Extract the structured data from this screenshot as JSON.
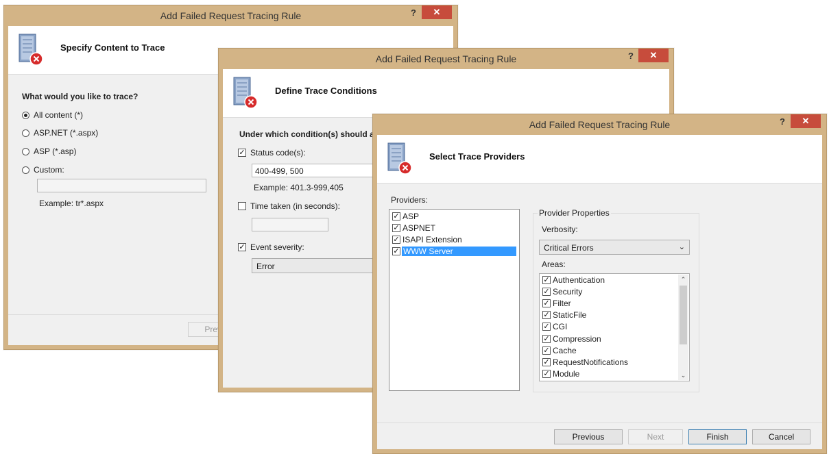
{
  "window_title": "Add Failed Request Tracing Rule",
  "help_glyph": "?",
  "close_glyph": "✕",
  "dialog1": {
    "header": "Specify Content to Trace",
    "question": "What would you like to trace?",
    "options": [
      "All content (*)",
      "ASP.NET (*.aspx)",
      "ASP (*.asp)",
      "Custom:"
    ],
    "selected_option": "All content (*)",
    "custom_value": "",
    "example": "Example: tr*.aspx",
    "previous_button_partial": "Prev"
  },
  "dialog2": {
    "header": "Define Trace Conditions",
    "question_partial": "Under which condition(s) should a re",
    "status_codes_label": "Status code(s):",
    "status_codes_checked": true,
    "status_codes_value": "400-499, 500",
    "status_codes_example": "Example: 401.3-999,405",
    "time_taken_label": "Time taken (in seconds):",
    "time_taken_checked": false,
    "time_taken_value": "",
    "event_severity_label": "Event severity:",
    "event_severity_checked": true,
    "event_severity_value": "Error"
  },
  "dialog3": {
    "header": "Select Trace Providers",
    "providers_label": "Providers:",
    "providers": [
      {
        "label": "ASP",
        "checked": true
      },
      {
        "label": "ASPNET",
        "checked": true
      },
      {
        "label": "ISAPI Extension",
        "checked": true
      },
      {
        "label": "WWW Server",
        "checked": true,
        "selected": true
      }
    ],
    "properties_group": "Provider Properties",
    "verbosity_label": "Verbosity:",
    "verbosity_value": "Critical Errors",
    "areas_label": "Areas:",
    "areas": [
      {
        "label": "Authentication",
        "checked": true
      },
      {
        "label": "Security",
        "checked": true
      },
      {
        "label": "Filter",
        "checked": true
      },
      {
        "label": "StaticFile",
        "checked": true
      },
      {
        "label": "CGI",
        "checked": true
      },
      {
        "label": "Compression",
        "checked": true
      },
      {
        "label": "Cache",
        "checked": true
      },
      {
        "label": "RequestNotifications",
        "checked": true
      },
      {
        "label": "Module",
        "checked": true
      }
    ],
    "buttons": {
      "previous": "Previous",
      "next": "Next",
      "finish": "Finish",
      "cancel": "Cancel"
    }
  },
  "colors": {
    "frame": "#d3b486",
    "close": "#c74c3c",
    "selection": "#3399ff"
  }
}
